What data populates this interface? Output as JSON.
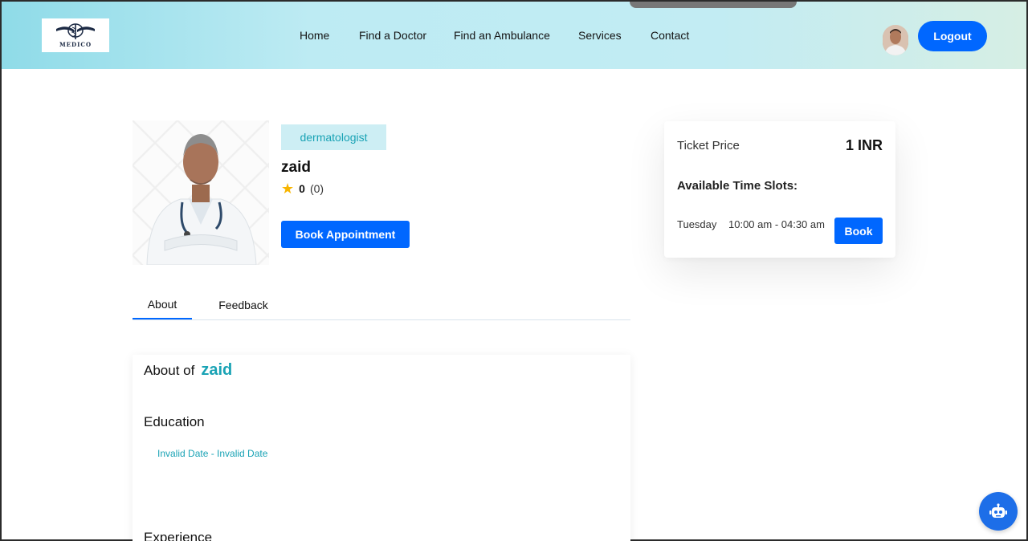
{
  "header": {
    "logo_text": "MEDICO",
    "nav": [
      {
        "label": "Home"
      },
      {
        "label": "Find a Doctor"
      },
      {
        "label": "Find an Ambulance"
      },
      {
        "label": "Services"
      },
      {
        "label": "Contact"
      }
    ],
    "logout_label": "Logout"
  },
  "doctor": {
    "specialization": "dermatologist",
    "name": "zaid",
    "rating": "0",
    "reviews": "(0)",
    "book_label": "Book Appointment"
  },
  "tabs": [
    {
      "label": "About"
    },
    {
      "label": "Feedback"
    }
  ],
  "about": {
    "heading_prefix": "About of",
    "name": "zaid",
    "education_title": "Education",
    "education_dates": "Invalid Date - Invalid Date",
    "experience_title": "Experience"
  },
  "pricing": {
    "ticket_label": "Ticket Price",
    "ticket_value": "1 INR",
    "slots_title": "Available Time Slots:",
    "slots": [
      {
        "day": "Tuesday",
        "time": "10:00 am - 04:30 am",
        "book_label": "Book"
      }
    ]
  },
  "colors": {
    "primary": "#0067ff",
    "accent_teal": "#1aa3b5",
    "badge_bg": "#cdeef4"
  },
  "icons": {
    "logo": "caduceus-logo-icon",
    "rating": "star-icon",
    "chatbot": "robot-icon"
  }
}
